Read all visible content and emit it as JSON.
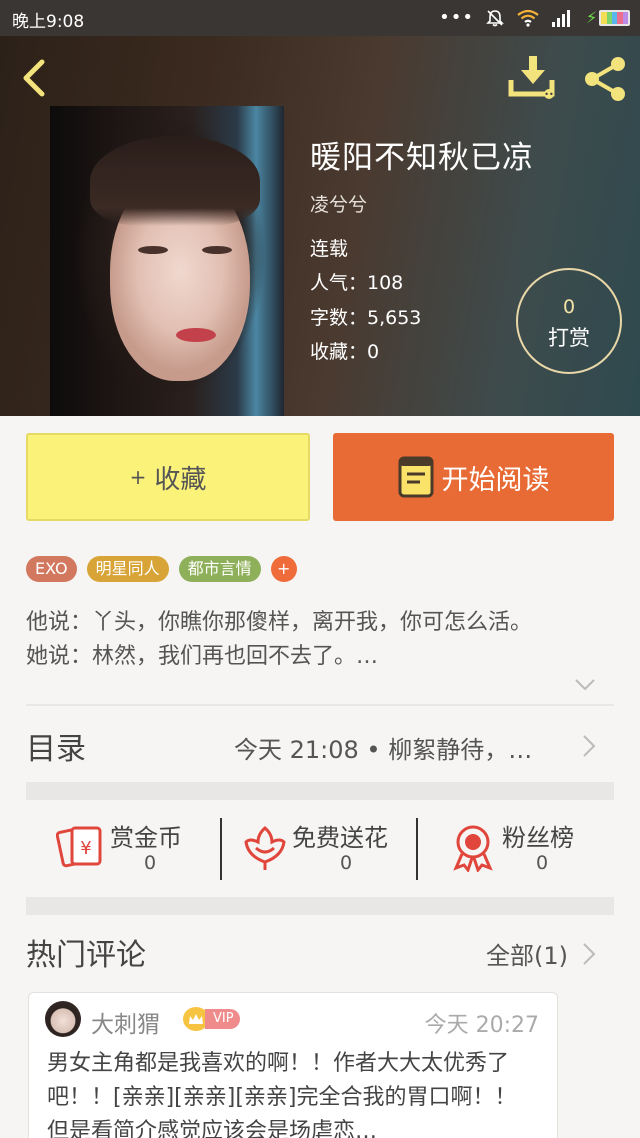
{
  "status_bar": {
    "time": "晚上9:08",
    "icons": [
      "more-dots-icon",
      "mute-bell-icon",
      "wifi-icon",
      "signal-icon",
      "charging-icon",
      "battery-icon"
    ]
  },
  "header": {
    "back_icon": "chevron-left-icon",
    "download_icon": "download-icon",
    "share_icon": "share-icon",
    "icon_color": "#f3e37c"
  },
  "book": {
    "title": "暖阳不知秋已凉",
    "author": "凌兮兮",
    "status": "连载",
    "popularity": "人气：108",
    "word_count": "字数：5,653",
    "favorites": "收藏：0"
  },
  "tip": {
    "count": "0",
    "label": "打赏"
  },
  "actions": {
    "favorite_plus": "+",
    "favorite_label": "收藏",
    "read_label": "开始阅读"
  },
  "tags": [
    {
      "label": "EXO",
      "color": "#d2785e"
    },
    {
      "label": "明星同人",
      "color": "#d9a437"
    },
    {
      "label": "都市言情",
      "color": "#8fb05a"
    }
  ],
  "tag_more": "+",
  "intro": {
    "line1": "他说：丫头，你瞧你那傻样，离开我，你可怎么活。",
    "line2": "她说：林然，我们再也回不去了。…"
  },
  "catalog": {
    "label": "目录",
    "latest": "今天 21:08 • 柳絮静待，…"
  },
  "stats": [
    {
      "name": "赏金币",
      "value": "0",
      "icon": "red-envelope-icon"
    },
    {
      "name": "免费送花",
      "value": "0",
      "icon": "flower-icon"
    },
    {
      "name": "粉丝榜",
      "value": "0",
      "icon": "award-ribbon-icon"
    }
  ],
  "comments": {
    "title": "热门评论",
    "all_label": "全部(1)",
    "items": [
      {
        "user": "大刺猬",
        "badge": "VIP",
        "time": "今天 20:27",
        "text": "男女主角都是我喜欢的啊！！作者大大太优秀了吧！！[亲亲][亲亲][亲亲]完全合我的胃口啊！！但是看简介感觉应该会是场虐恋…"
      }
    ]
  },
  "colors": {
    "accent_orange": "#e86a35",
    "favorite_yellow": "#fbf27a",
    "icon_red": "#e0463b"
  }
}
